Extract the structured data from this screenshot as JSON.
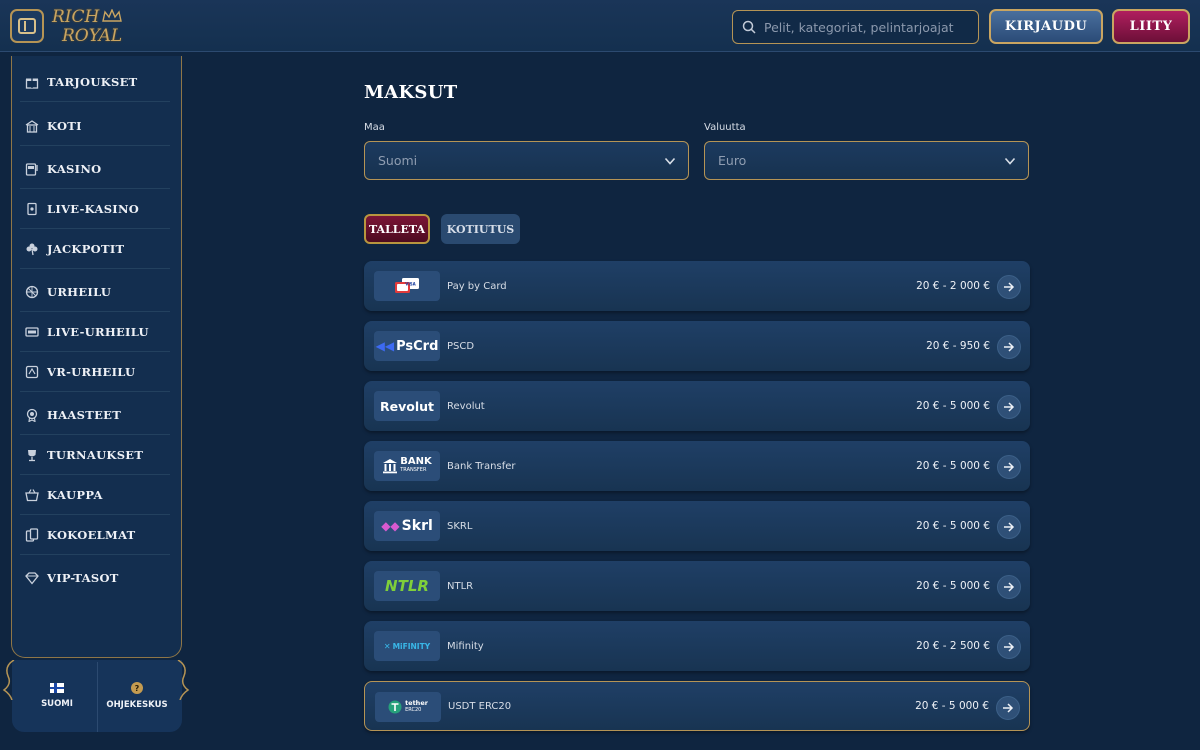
{
  "header": {
    "logo_line1": "RICH",
    "logo_line2": "ROYAL",
    "search_placeholder": "Pelit, kategoriat, pelintarjoajat",
    "login_label": "KIRJAUDU",
    "join_label": "LIITY"
  },
  "sidebar": {
    "items": [
      {
        "label": "TARJOUKSET",
        "icon": "gift-icon"
      },
      {
        "label": "KOTI",
        "icon": "home-icon"
      },
      {
        "label": "KASINO",
        "icon": "slot-machine-icon"
      },
      {
        "label": "LIVE-KASINO",
        "icon": "card-icon"
      },
      {
        "label": "JACKPOTIT",
        "icon": "clover-icon"
      },
      {
        "label": "URHEILU",
        "icon": "ball-icon"
      },
      {
        "label": "LIVE-URHEILU",
        "icon": "live-tv-icon"
      },
      {
        "label": "VR-URHEILU",
        "icon": "vr-icon"
      },
      {
        "label": "HAASTEET",
        "icon": "medal-icon"
      },
      {
        "label": "TURNAUKSET",
        "icon": "trophy-icon"
      },
      {
        "label": "KAUPPA",
        "icon": "basket-icon"
      },
      {
        "label": "KOKOELMAT",
        "icon": "cards-icon"
      },
      {
        "label": "VIP-TASOT",
        "icon": "diamond-icon"
      }
    ],
    "footer": {
      "language_label": "SUOMI",
      "help_label": "OHJEKESKUS"
    }
  },
  "main": {
    "title": "MAKSUT",
    "country_label": "Maa",
    "country_value": "Suomi",
    "currency_label": "Valuutta",
    "currency_value": "Euro",
    "tab_deposit": "TALLETA",
    "tab_withdraw": "KOTIUTUS",
    "methods": [
      {
        "name": "Pay by Card",
        "logo": "VISA",
        "range": "20 € - 2 000 €"
      },
      {
        "name": "PSCD",
        "logo": "PsCrd",
        "range": "20 € - 950 €"
      },
      {
        "name": "Revolut",
        "logo": "Revolut",
        "range": "20 € - 5 000 €"
      },
      {
        "name": "Bank Transfer",
        "logo": "BANK",
        "logo_sub": "TRANSFER",
        "range": "20 € - 5 000 €"
      },
      {
        "name": "SKRL",
        "logo": "Skrl",
        "range": "20 € - 5 000 €"
      },
      {
        "name": "NTLR",
        "logo": "NTLR",
        "range": "20 € - 5 000 €"
      },
      {
        "name": "Mifinity",
        "logo": "MiFINITY",
        "range": "20 € - 2 500 €"
      },
      {
        "name": "USDT ERC20",
        "logo": "tether",
        "logo_sub": "ERC20",
        "range": "20 € - 5 000 €"
      }
    ]
  },
  "colors": {
    "background": "#0f2540",
    "gold": "#b59455",
    "deposit_tab": "#7b1536",
    "join_button": "#b01f5e"
  }
}
